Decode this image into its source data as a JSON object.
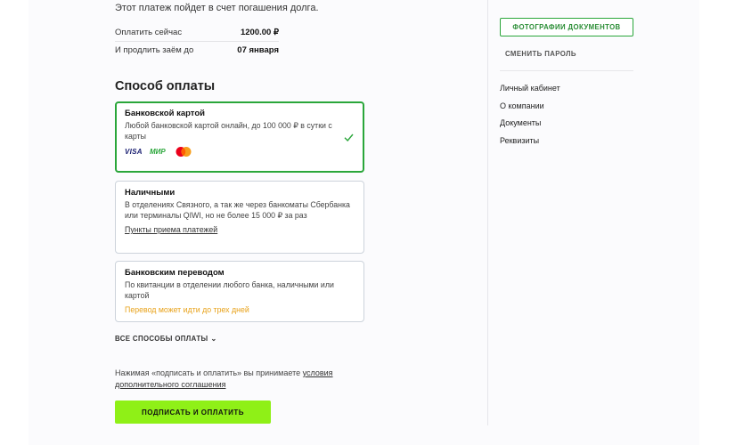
{
  "notice": "Этот платеж пойдет в счет погашения долга.",
  "summary": {
    "pay_now_label": "Оплатить сейчас",
    "pay_now_value": "1200.00 ₽",
    "extend_label": "И продлить заём до",
    "extend_value": "07 января"
  },
  "payment_section": {
    "title": "Способ оплаты",
    "methods": [
      {
        "title": "Банковской картой",
        "description": "Любой банковской картой онлайн, до 100 000 ₽ в сутки с карты",
        "logos": [
          "VISA",
          "МИР",
          "mastercard-icon"
        ],
        "selected": true
      },
      {
        "title": "Наличными",
        "description": "В отделениях Связного, а так же через банкоматы Сбербанка или терминалы QIWI, но не более 15 000 ₽ за раз",
        "link": "Пункты приема платежей",
        "selected": false
      },
      {
        "title": "Банковским переводом",
        "description": "По квитанции в отделении любого банка, наличными или картой",
        "warning": "Перевод может идти до трех дней",
        "selected": false
      }
    ],
    "all_methods": "ВСЕ СПОСОБЫ ОПЛАТЫ"
  },
  "agreement": {
    "text": "Нажимая «подписать и оплатить» вы принимаете ",
    "link": "условия дополнительного соглашения"
  },
  "submit_label": "ПОДПИСАТЬ И ОПЛАТИТЬ",
  "sidebar": {
    "docs_button": "ФОТОГРАФИИ ДОКУМЕНТОВ",
    "change_password": "СМЕНИТЬ ПАРОЛЬ",
    "nav": [
      "Личный кабинет",
      "О компании",
      "Документы",
      "Реквизиты"
    ]
  },
  "colors": {
    "accent_green": "#2aa63a",
    "button_lime": "#8ff017",
    "warning_orange": "#e8a21a"
  }
}
